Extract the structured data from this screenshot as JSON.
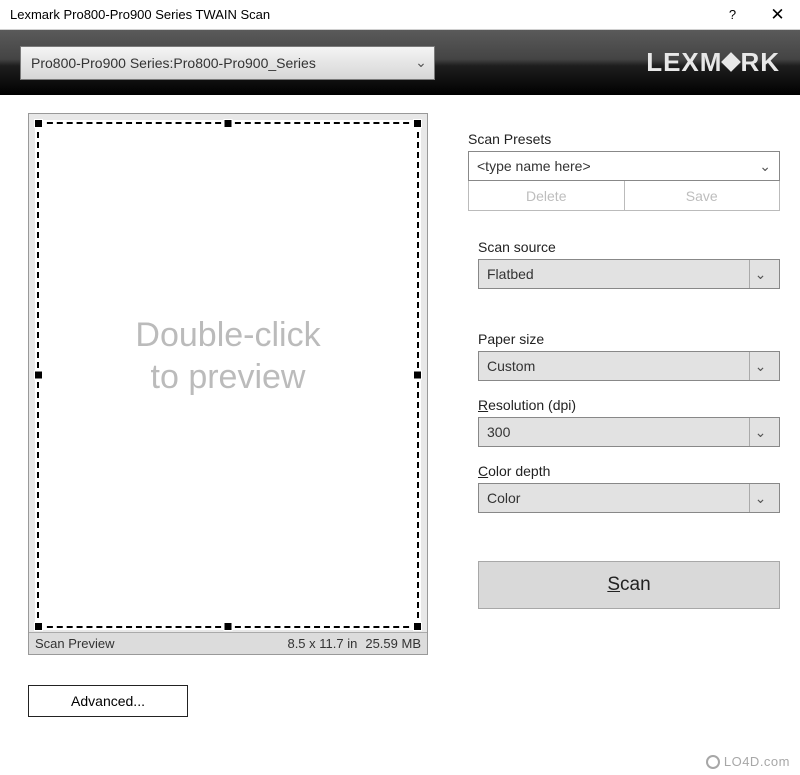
{
  "window": {
    "title": "Lexmark Pro800-Pro900 Series TWAIN Scan"
  },
  "topbar": {
    "scanner": "Pro800-Pro900 Series:Pro800-Pro900_Series",
    "logo_left": "LEXM",
    "logo_right": "RK"
  },
  "preview": {
    "placeholder_line1": "Double-click",
    "placeholder_line2": "to preview",
    "status_label": "Scan Preview",
    "status_size": "8.5 x 11.7 in",
    "status_filesize": "25.59 MB"
  },
  "buttons": {
    "advanced": "Advanced...",
    "delete": "Delete",
    "save": "Save",
    "scan_prefix": "S",
    "scan_rest": "can"
  },
  "labels": {
    "scan_presets": "Scan Presets",
    "scan_source": "Scan source",
    "paper_size": "Paper size",
    "resolution_prefix": "R",
    "resolution_rest": "esolution (dpi)",
    "color_prefix": "C",
    "color_rest": "olor depth"
  },
  "fields": {
    "preset_placeholder": "<type name here>",
    "scan_source": "Flatbed",
    "paper_size": "Custom",
    "resolution": "300",
    "color_depth": "Color"
  },
  "watermark": "LO4D.com"
}
